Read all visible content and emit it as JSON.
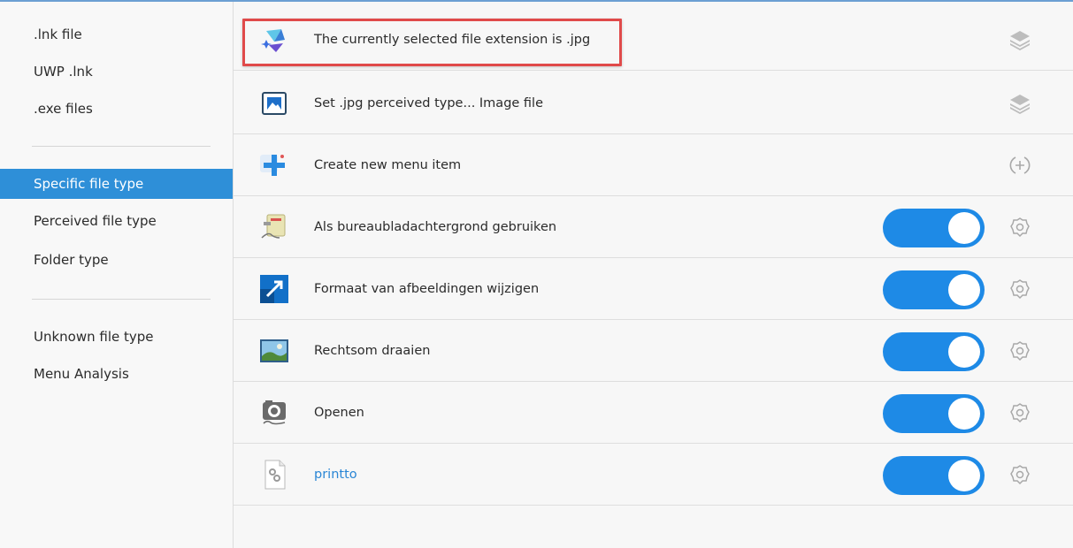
{
  "sidebar": {
    "items": [
      {
        "label": ".lnk file"
      },
      {
        "label": "UWP .lnk"
      },
      {
        "label": ".exe files"
      },
      {
        "label": "Specific file type",
        "selected": true
      },
      {
        "label": "Perceived file type"
      },
      {
        "label": "Folder type"
      },
      {
        "label": "Unknown file type"
      },
      {
        "label": "Menu Analysis"
      }
    ]
  },
  "rows": [
    {
      "label": "The currently selected file extension is .jpg",
      "icon": "app-logo-icon",
      "right_icon": "layers-icon"
    },
    {
      "label": "Set .jpg perceived type... Image file",
      "icon": "image-icon",
      "right_icon": "layers-icon"
    },
    {
      "label": "Create new menu item",
      "icon": "plus-icon",
      "right_icon": "add-circle-icon"
    },
    {
      "label": "Als bureaubladachtergrond gebruiken",
      "icon": "wallpaper-plug-icon",
      "toggle": true,
      "right_icon": "gear-icon"
    },
    {
      "label": "Formaat van afbeeldingen wijzigen",
      "icon": "resize-arrow-icon",
      "toggle": true,
      "right_icon": "gear-icon"
    },
    {
      "label": "Rechtsom draaien",
      "icon": "landscape-photo-icon",
      "toggle": true,
      "right_icon": "gear-icon"
    },
    {
      "label": "Openen",
      "icon": "camera-icon",
      "toggle": true,
      "right_icon": "gear-icon"
    },
    {
      "label": "printto",
      "icon": "settings-file-icon",
      "toggle": true,
      "right_icon": "gear-icon"
    }
  ],
  "colors": {
    "accent": "#2e8fd8",
    "toggle_on": "#1e8ae6",
    "highlight": "#e04a4a",
    "link": "#2a86d5"
  }
}
